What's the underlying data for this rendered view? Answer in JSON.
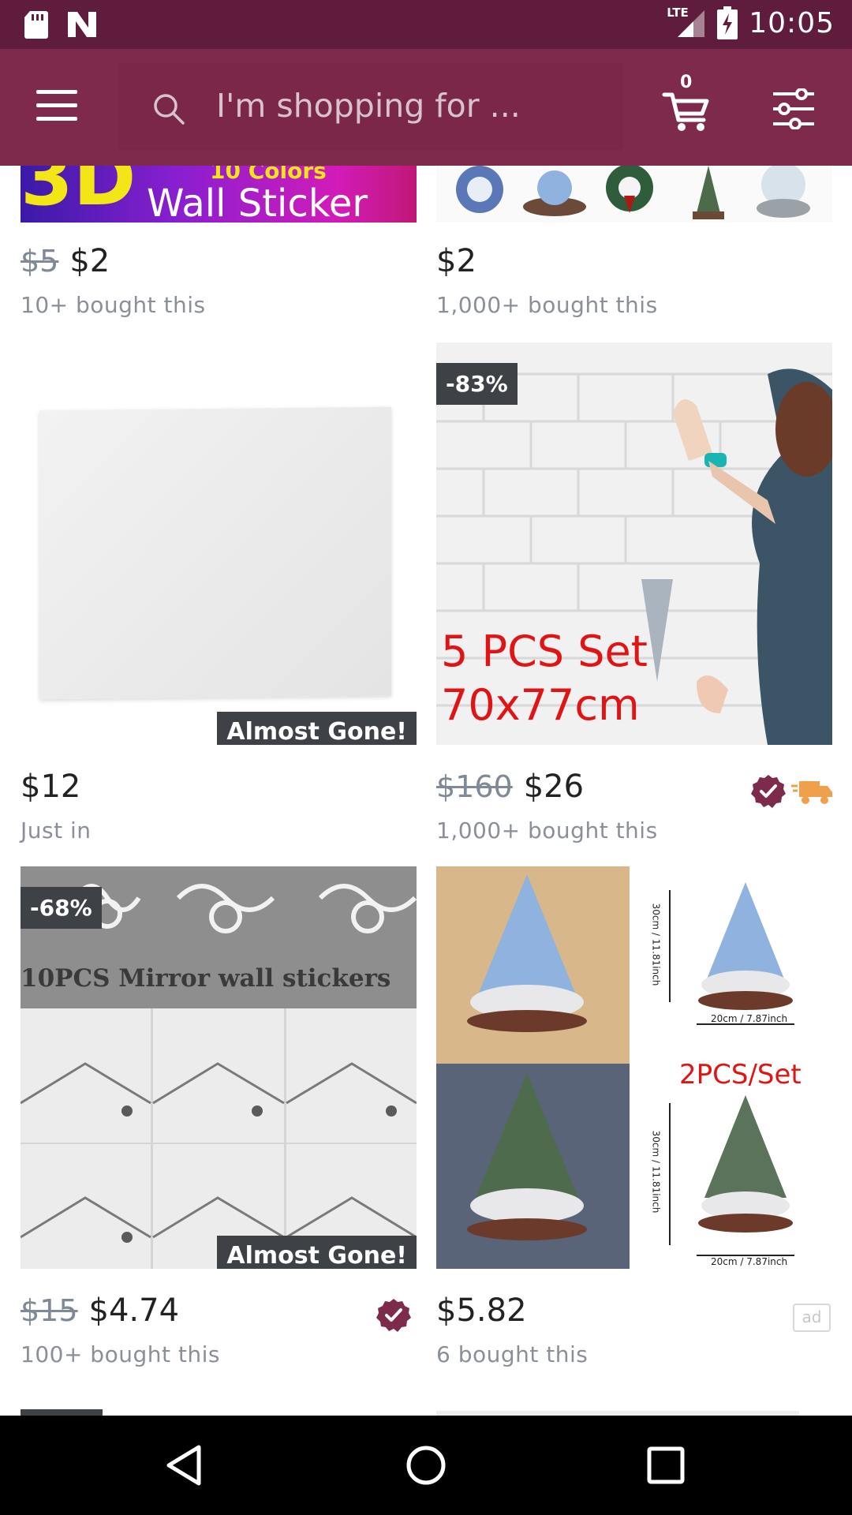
{
  "status_bar": {
    "time": "10:05",
    "network": "LTE"
  },
  "app_bar": {
    "search_placeholder": "I'm shopping for ...",
    "cart_count": "0"
  },
  "products": [
    {
      "image_text_line1": "10 Colors",
      "image_text_line2": "Wall Sticker",
      "image_logo": "3D",
      "old_price": "$5",
      "price": "$2",
      "sold": "10+ bought this"
    },
    {
      "old_price": "",
      "price": "$2",
      "sold": "1,000+ bought this"
    },
    {
      "badge": "Almost Gone!",
      "price": "$12",
      "sold": "Just in"
    },
    {
      "discount": "-83%",
      "image_text_line1": "5 PCS Set",
      "image_text_line2": "70x77cm",
      "old_price": "$160",
      "price": "$26",
      "sold": "1,000+ bought this"
    },
    {
      "discount": "-68%",
      "image_caption": "10PCS Mirror wall stickers",
      "badge": "Almost Gone!",
      "old_price": "$15",
      "price": "$4.74",
      "sold": "100+ bought this"
    },
    {
      "image_set_label": "2PCS/Set",
      "dim_h": "30cm / 11.81inch",
      "dim_w": "20cm / 7.87inch",
      "price": "$5.82",
      "sold": "6 bought this",
      "ad_label": "ad"
    }
  ],
  "colors": {
    "status_bar": "#5f1c3c",
    "app_bar": "#7d2a4d",
    "badge_dark": "#3e4247",
    "verified": "#7d2a4d",
    "truck": "#f0a04b"
  }
}
